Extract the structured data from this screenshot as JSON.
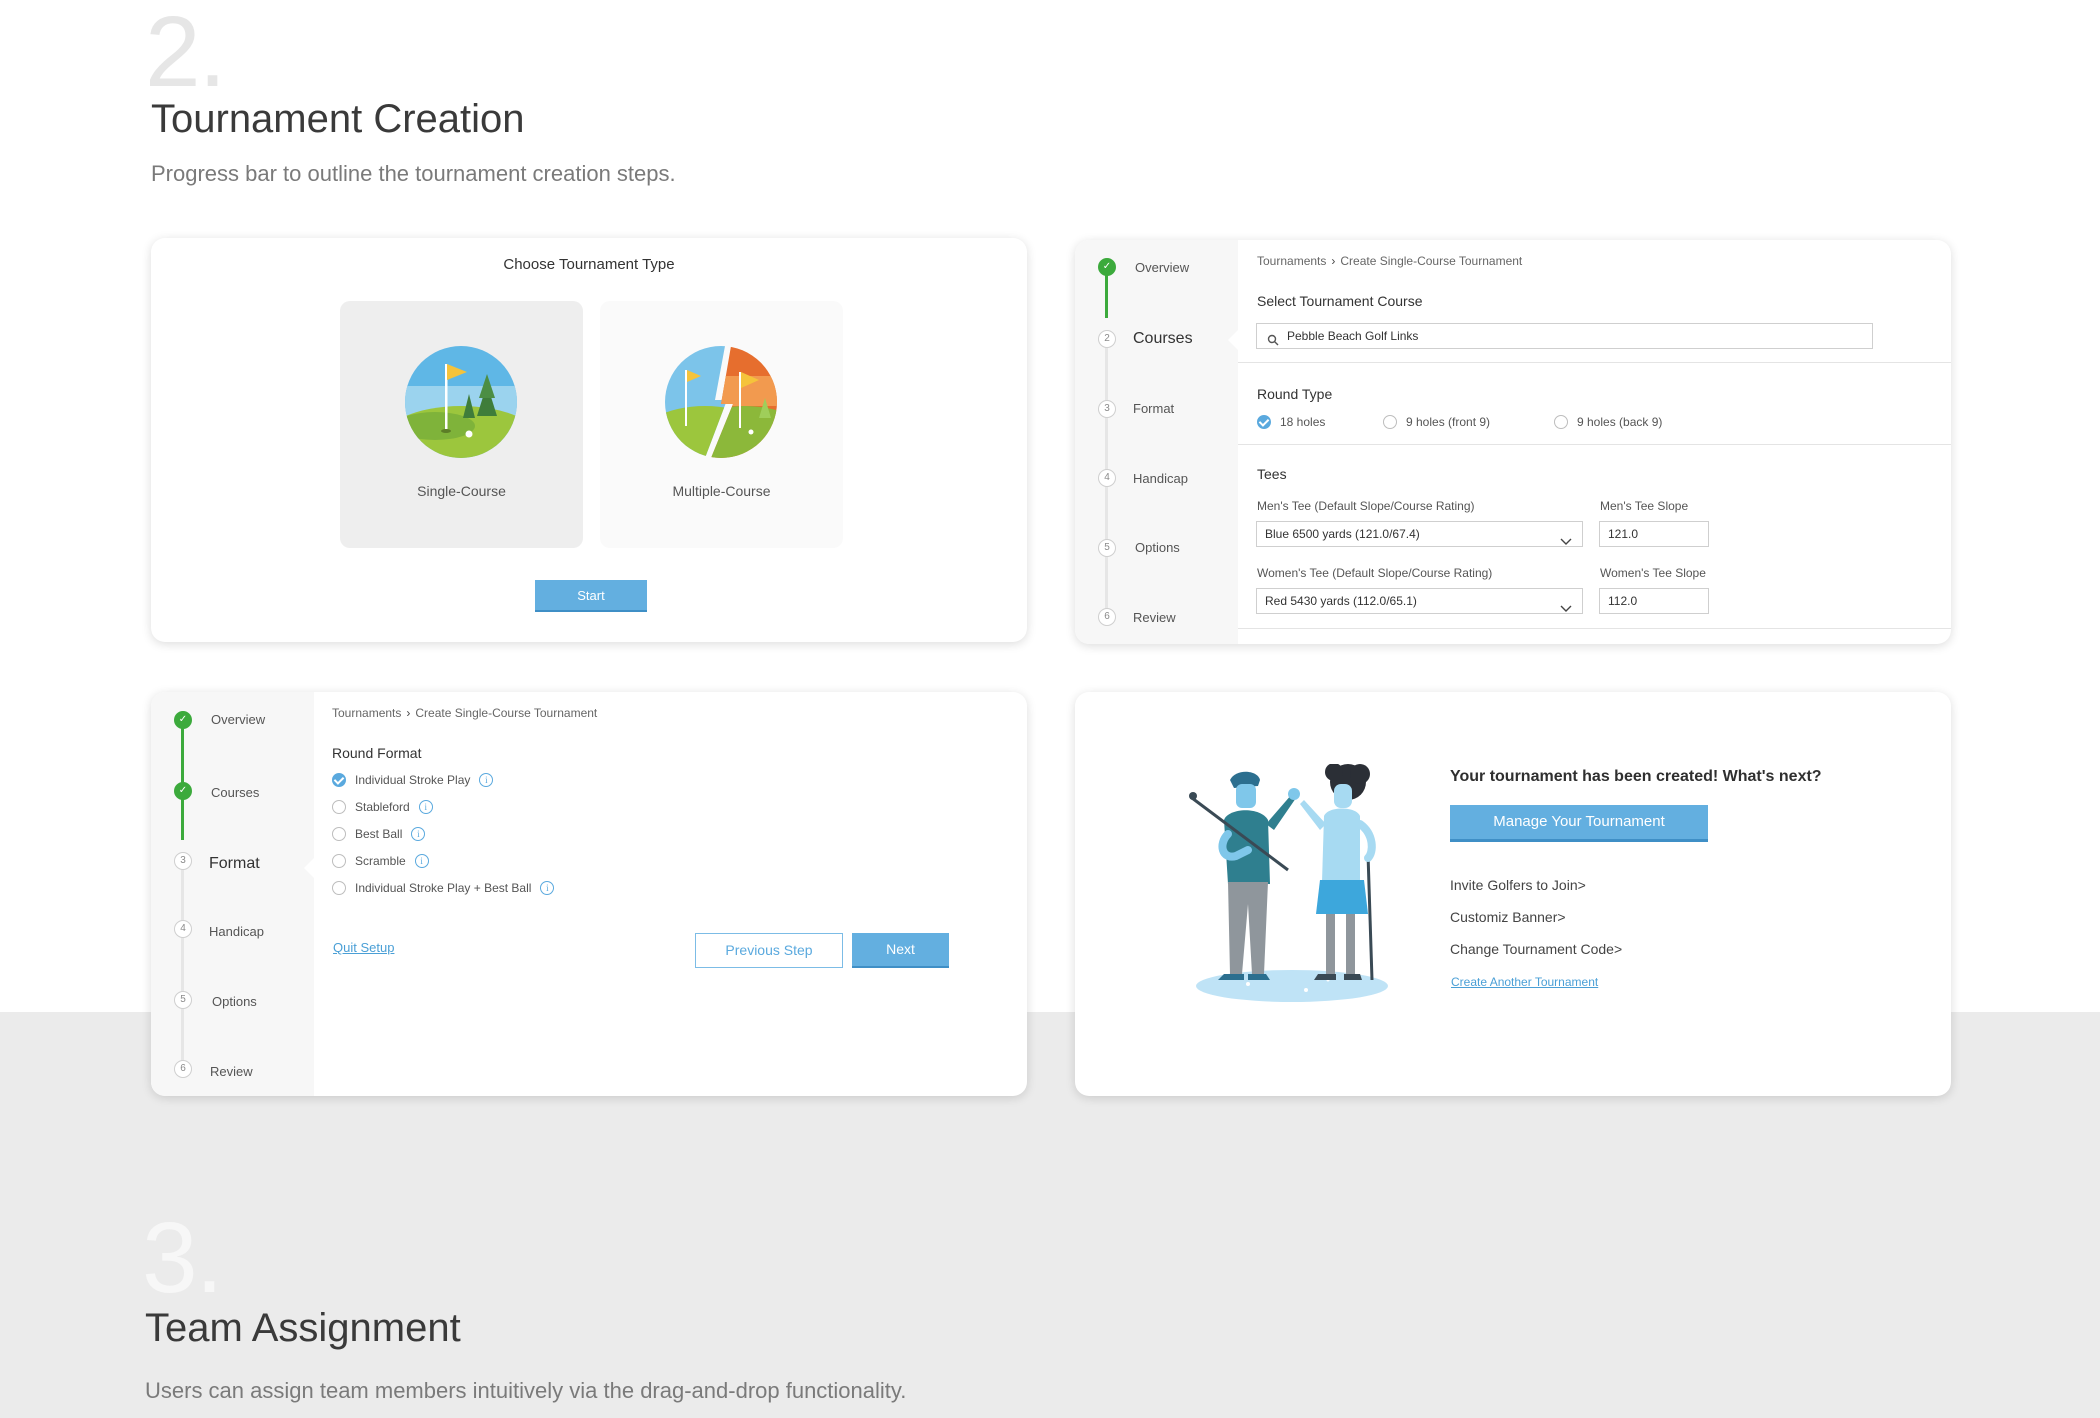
{
  "section2": {
    "number": "2.",
    "title": "Tournament Creation",
    "description": "Progress bar to outline the tournament creation steps."
  },
  "choose_type": {
    "title": "Choose Tournament Type",
    "options": [
      {
        "label": "Single-Course",
        "icon": "golf-flag-icon",
        "selected": true
      },
      {
        "label": "Multiple-Course",
        "icon": "split-golf-flags-icon",
        "selected": false
      }
    ],
    "start_label": "Start"
  },
  "steps": [
    {
      "num": "1",
      "label": "Overview"
    },
    {
      "num": "2",
      "label": "Courses"
    },
    {
      "num": "3",
      "label": "Format"
    },
    {
      "num": "4",
      "label": "Handicap"
    },
    {
      "num": "5",
      "label": "Options"
    },
    {
      "num": "6",
      "label": "Review"
    }
  ],
  "breadcrumb": {
    "root": "Tournaments",
    "current": "Create Single-Course Tournament"
  },
  "courses_panel": {
    "select_course_label": "Select Tournament Course",
    "search_value": "Pebble Beach Golf Links",
    "round_type_label": "Round Type",
    "round_types": [
      {
        "label": "18 holes",
        "checked": true
      },
      {
        "label": "9 holes (front 9)",
        "checked": false
      },
      {
        "label": "9 holes (back 9)",
        "checked": false
      }
    ],
    "tees_label": "Tees",
    "mens_tee_label": "Men's Tee (Default Slope/Course Rating)",
    "mens_tee_value": "Blue 6500 yards (121.0/67.4)",
    "mens_slope_label": "Men's Tee Slope",
    "mens_slope_value": "121.0",
    "womens_tee_label": "Women's Tee (Default Slope/Course Rating)",
    "womens_tee_value": "Red 5430 yards (112.0/65.1)",
    "womens_slope_label": "Women's Tee Slope",
    "womens_slope_value": "112.0"
  },
  "format_panel": {
    "round_format_label": "Round Format",
    "formats": [
      {
        "label": "Individual Stroke Play",
        "checked": true
      },
      {
        "label": "Stableford",
        "checked": false
      },
      {
        "label": "Best Ball",
        "checked": false
      },
      {
        "label": "Scramble",
        "checked": false
      },
      {
        "label": "Individual Stroke Play + Best Ball",
        "checked": false
      }
    ],
    "info_glyph": "i",
    "quit_label": "Quit Setup",
    "prev_label": "Previous Step",
    "next_label": "Next"
  },
  "created_panel": {
    "title": "Your tournament has been created! What's next?",
    "manage_label": "Manage Your Tournament",
    "links": [
      "Invite Golfers to Join>",
      "Customiz Banner>",
      "Change Tournament Code>"
    ],
    "create_another_label": "Create Another Tournament"
  },
  "section3": {
    "number": "3.",
    "title": "Team Assignment",
    "description": "Users can assign team members intuitively via the drag-and-drop functionality."
  },
  "colors": {
    "accent": "#63afe0",
    "success": "#3caa3c",
    "link": "#4a9fd6"
  }
}
